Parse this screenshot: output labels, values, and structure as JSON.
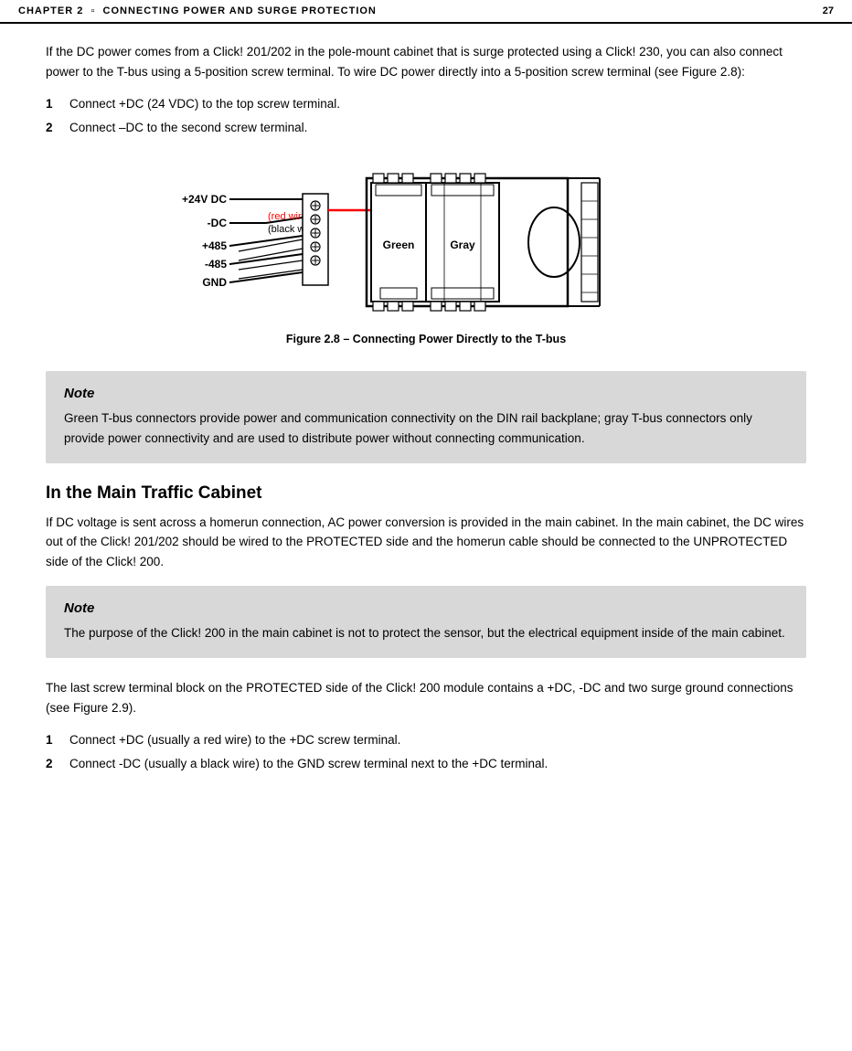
{
  "header": {
    "chapter": "CHAPTER 2",
    "separator": "▫",
    "title": "CONNECTING POWER AND SURGE PROTECTION",
    "page_number": "27"
  },
  "intro": {
    "text": "If the DC power comes from a Click! 201/202 in the pole-mount cabinet that is surge protected using a Click! 230, you can also connect power to the T-bus using a 5-position screw terminal. To wire DC power directly into a 5-position screw terminal (see Figure 2.8):"
  },
  "steps_1": [
    {
      "num": "1",
      "text": "Connect +DC (24 VDC) to the top screw terminal."
    },
    {
      "num": "2",
      "text": "Connect –DC to the second screw terminal."
    }
  ],
  "diagram": {
    "labels": {
      "plus24vdc": "+24V DC",
      "minus_dc": "-DC",
      "plus485": "+485",
      "minus485": "-485",
      "gnd": "GND",
      "red_wire": "(red wire)",
      "black_wire": "(black wire)",
      "green": "Green",
      "gray": "Gray"
    },
    "caption": "Figure 2.8 – Connecting Power Directly to the T-bus"
  },
  "note1": {
    "title": "Note",
    "text": "Green T-bus connectors provide power and communication connectivity on the DIN rail backplane; gray T-bus connectors only provide power connectivity and are used to distribute power without connecting communication."
  },
  "section2": {
    "heading": "In the Main Traffic Cabinet",
    "text": "If DC voltage is sent across a homerun connection, AC power conversion is provided in the main cabinet. In the main cabinet, the DC wires out of the Click! 201/202 should be wired to the PROTECTED side and the homerun cable should be connected to the UNPROTECTED side of the Click! 200."
  },
  "note2": {
    "title": "Note",
    "text": "The purpose of the Click! 200 in the main cabinet is not to protect the sensor, but the electrical equipment inside of the main cabinet."
  },
  "closing_text": "The last screw terminal block on the PROTECTED side of the Click! 200 module contains a +DC, -DC and two surge ground connections (see Figure 2.9).",
  "steps_2": [
    {
      "num": "1",
      "text": "Connect +DC (usually a red wire) to the +DC screw terminal."
    },
    {
      "num": "2",
      "text": "Connect -DC (usually a black wire) to the GND screw terminal next to the +DC terminal."
    }
  ]
}
